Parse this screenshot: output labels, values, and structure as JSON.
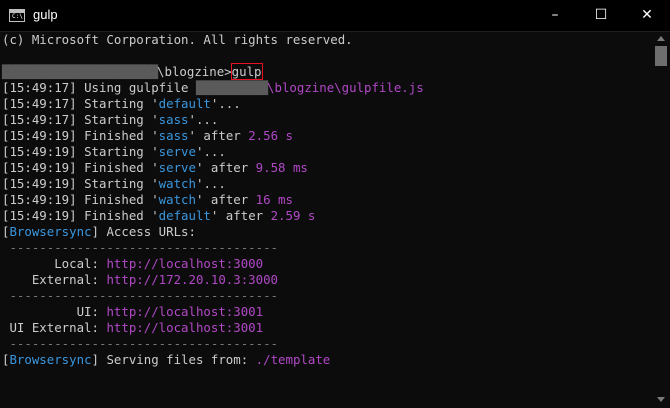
{
  "window": {
    "title": "gulp",
    "app_icon_text": "C:\\",
    "controls": {
      "minimize": "–",
      "maximize": "☐",
      "close": "✕"
    }
  },
  "terminal": {
    "copyright": "(c) Microsoft Corporation. All rights reserved.",
    "prompt": {
      "path_blur": "████████████████████████",
      "path_tail": "\\blogzine>",
      "command": "gulp"
    },
    "log": [
      {
        "time": "[15:49:17]",
        "prefix": " Using gulpfile ",
        "path_blur": "███████████",
        "tail": "\\blogzine\\gulpfile.js"
      },
      {
        "time": "[15:49:17]",
        "verb": " Starting '",
        "task": "default",
        "after": "'...",
        "duration": ""
      },
      {
        "time": "[15:49:17]",
        "verb": " Starting '",
        "task": "sass",
        "after": "'...",
        "duration": ""
      },
      {
        "time": "[15:49:19]",
        "verb": " Finished '",
        "task": "sass",
        "after": "' after ",
        "duration": "2.56 s"
      },
      {
        "time": "[15:49:19]",
        "verb": " Starting '",
        "task": "serve",
        "after": "'...",
        "duration": ""
      },
      {
        "time": "[15:49:19]",
        "verb": " Finished '",
        "task": "serve",
        "after": "' after ",
        "duration": "9.58 ms"
      },
      {
        "time": "[15:49:19]",
        "verb": " Starting '",
        "task": "watch",
        "after": "'...",
        "duration": ""
      },
      {
        "time": "[15:49:19]",
        "verb": " Finished '",
        "task": "watch",
        "after": "' after ",
        "duration": "16 ms"
      },
      {
        "time": "[15:49:19]",
        "verb": " Finished '",
        "task": "default",
        "after": "' after ",
        "duration": "2.59 s"
      }
    ],
    "browsersync": {
      "tag": "Browsersync",
      "access_text": "] Access URLs:",
      "separator": " ------------------------------------",
      "urls": [
        {
          "label": "       Local: ",
          "url": "http://localhost:3000"
        },
        {
          "label": "    External: ",
          "url": "http://172.20.10.3:3000"
        },
        {
          "label": "          UI: ",
          "url": "http://localhost:3001"
        },
        {
          "label": " UI External: ",
          "url": "http://localhost:3001"
        }
      ],
      "serving_text": "] Serving files from: ",
      "serving_path": "./template"
    }
  }
}
